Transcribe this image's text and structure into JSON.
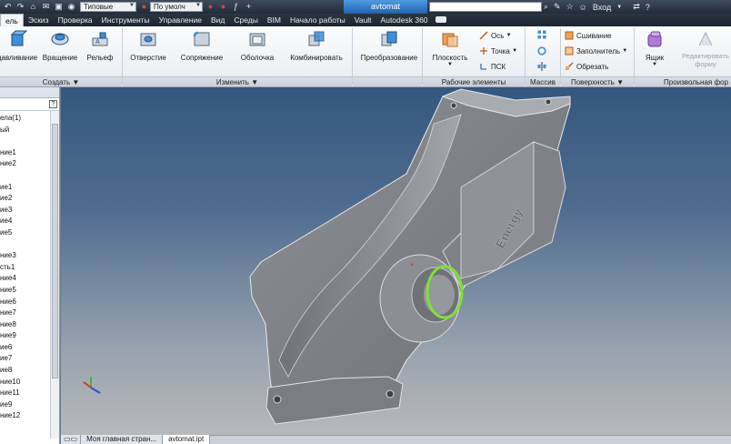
{
  "quick_access": {
    "style_combo": "Типовые",
    "color_combo": "По умолч",
    "document_title": "avtomat",
    "login_label": "Вход"
  },
  "ribbon_tabs": [
    "ель",
    "Эскиз",
    "Проверка",
    "Инструменты",
    "Управление",
    "Вид",
    "Среды",
    "BIM",
    "Начало работы",
    "Vault",
    "Autodesk 360"
  ],
  "ribbon": {
    "create": {
      "label": "Создать",
      "buttons": [
        "давливание",
        "Вращение",
        "Рельеф"
      ]
    },
    "modify": {
      "label": "Изменить",
      "buttons": [
        "Отверстие",
        "Сопряжение",
        "Оболочка",
        "Комбинировать"
      ]
    },
    "transform": {
      "button": "Преобразование"
    },
    "work_features": {
      "label": "Рабочие элементы",
      "plane": "Плоскость",
      "axis": "Ось",
      "point": "Точка",
      "ucs": "ПСК"
    },
    "pattern": {
      "label": "Массив"
    },
    "surface": {
      "label": "Поверхность",
      "items": [
        "Сшивание",
        "Заполнитель",
        "Обрезать"
      ]
    },
    "box": {
      "button": "Ящик"
    },
    "freeform": {
      "label": "Произвольная фор",
      "edit_form": [
        "Редактировать",
        "форму"
      ]
    }
  },
  "browser": {
    "items": [
      "ела(1)",
      "ый",
      "",
      "ние1",
      "ние2",
      "",
      "ие1",
      "ие2",
      "ие3",
      "ие4",
      "ие5",
      "",
      "ние3",
      "сть1",
      "ние4",
      "ние5",
      "ние6",
      "ние7",
      "ние8",
      "ние9",
      "ие6",
      "ие7",
      "ие8",
      "ние10",
      "ние11",
      "ие9",
      "ние12"
    ]
  },
  "model": {
    "engraved_text": "Energy"
  },
  "doc_tabs": [
    "Моя главная стран...",
    "avtomat.ipt"
  ],
  "colors": {
    "selection_ring": "#7fe03a",
    "model_face": "#7b7d80",
    "viewport_top": "#34577f",
    "viewport_bottom": "#b7b9bb"
  }
}
